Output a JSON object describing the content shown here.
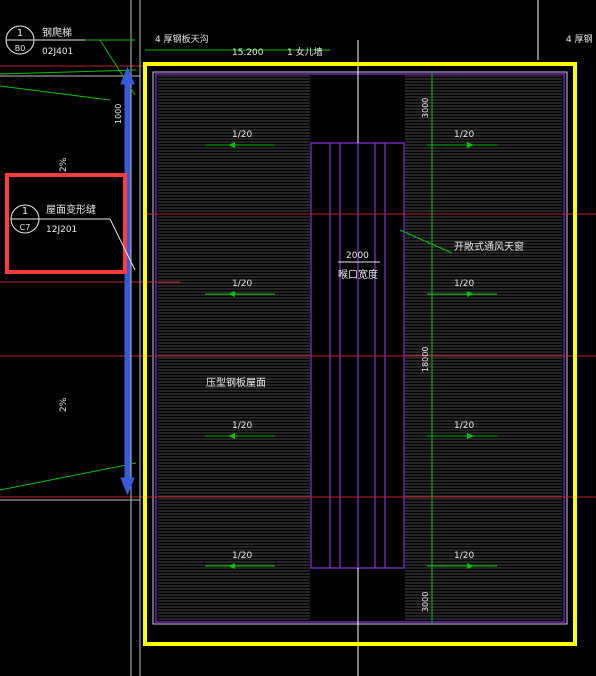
{
  "colors": {
    "background": "#000000",
    "yellow_border": "#ffff00",
    "red_frame": "#ff3b3b",
    "blue_arrow": "#3a5bd9",
    "grid_red": "#c0202a",
    "green": "#00c000",
    "purple": "#8a2be2",
    "hatch": "#9a9a9a",
    "text_white": "#e8e8e8"
  },
  "annotations": {
    "downspout_label": "钢爬梯",
    "downspout_num_top": "1",
    "downspout_num_bottom": "B0",
    "downspout_ref": "02J401",
    "gutter_left": "4 厚钢板天沟",
    "gutter_right": "4 厚钢",
    "elevation": "15.200",
    "parapet": "1 女儿墙",
    "dim_1000": "1000",
    "slope_left_upper": "2%",
    "slope_left_lower": "2%",
    "joint_num_top": "1",
    "joint_num_bottom": "C7",
    "joint_label": "屋面变形缝",
    "joint_ref": "12J201",
    "skylight_label": "开敞式通风天窗",
    "opening_dim": "2000",
    "opening_label": "喉口宽度",
    "roof_material": "压型钢板屋面",
    "dim_top": "3000",
    "dim_mid": "18000",
    "dim_bottom": "3000",
    "slope": "1/20"
  }
}
